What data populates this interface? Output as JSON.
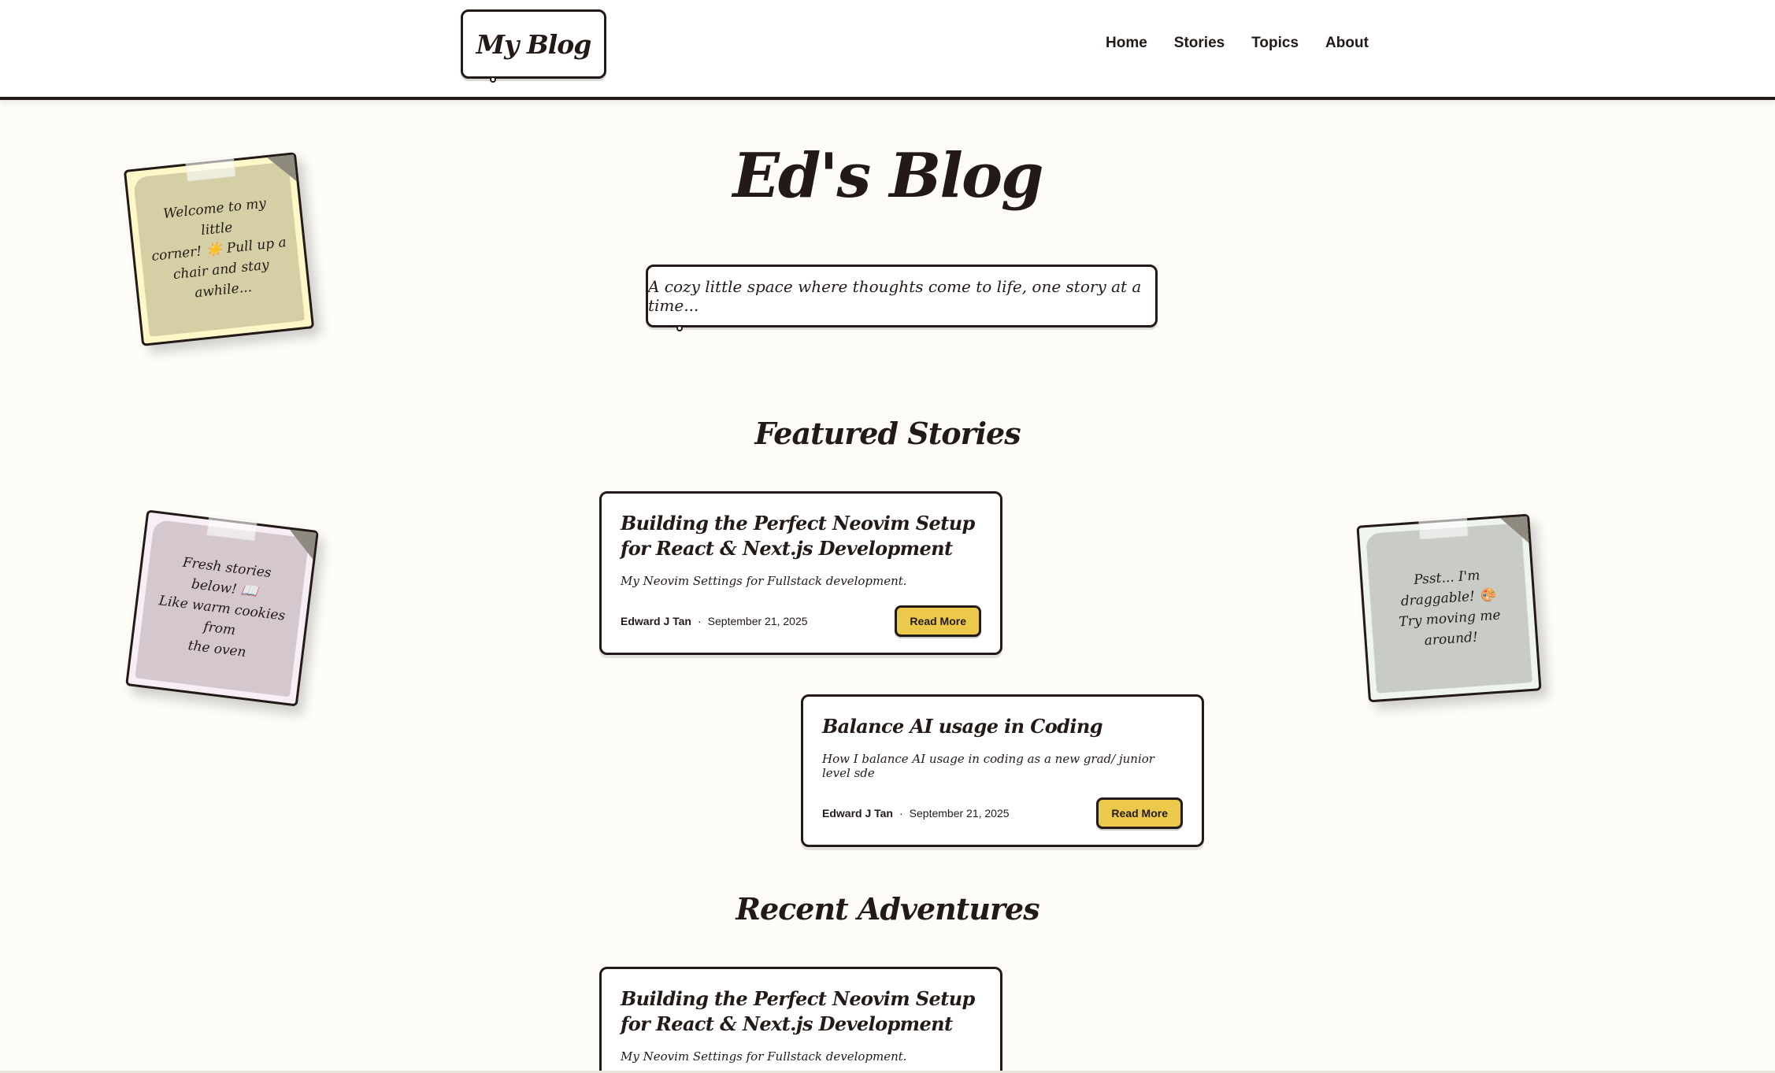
{
  "header": {
    "logo": "My Blog",
    "nav": [
      "Home",
      "Stories",
      "Topics",
      "About"
    ]
  },
  "hero": {
    "title": "Ed's Blog",
    "tagline": "A cozy little space where thoughts come to life, one story at a time..."
  },
  "notes": [
    {
      "text_lines": [
        "Welcome to my little",
        "corner! ☀️  Pull up a",
        "chair and stay awhile..."
      ],
      "color": "#d5cfa6"
    },
    {
      "text_lines": [
        "Fresh stories below! 📖",
        "Like warm cookies from",
        "the oven"
      ],
      "color": "#d4c8ce"
    },
    {
      "text_lines": [
        "Psst... I'm draggable! 🎨",
        "Try moving me around!"
      ],
      "color": "#c9ccc6"
    }
  ],
  "featured": {
    "title": "Featured Stories",
    "cards": [
      {
        "title": "Building the Perfect Neovim Setup for React & Next.js Development",
        "description": "My Neovim Settings for Fullstack development.",
        "author": "Edward J Tan",
        "date": "September 21, 2025",
        "button": "Read More"
      },
      {
        "title": "Balance AI usage in Coding",
        "description": "How I balance AI usage in coding as a new grad/ junior level sde",
        "author": "Edward J Tan",
        "date": "September 21, 2025",
        "button": "Read More"
      }
    ]
  },
  "recent": {
    "title": "Recent Adventures",
    "cards": [
      {
        "title": "Building the Perfect Neovim Setup for React & Next.js Development",
        "description": "My Neovim Settings for Fullstack development."
      }
    ]
  },
  "colors": {
    "background": "#fdfcf7",
    "ink": "#231a17",
    "button": "#ecc94b"
  }
}
